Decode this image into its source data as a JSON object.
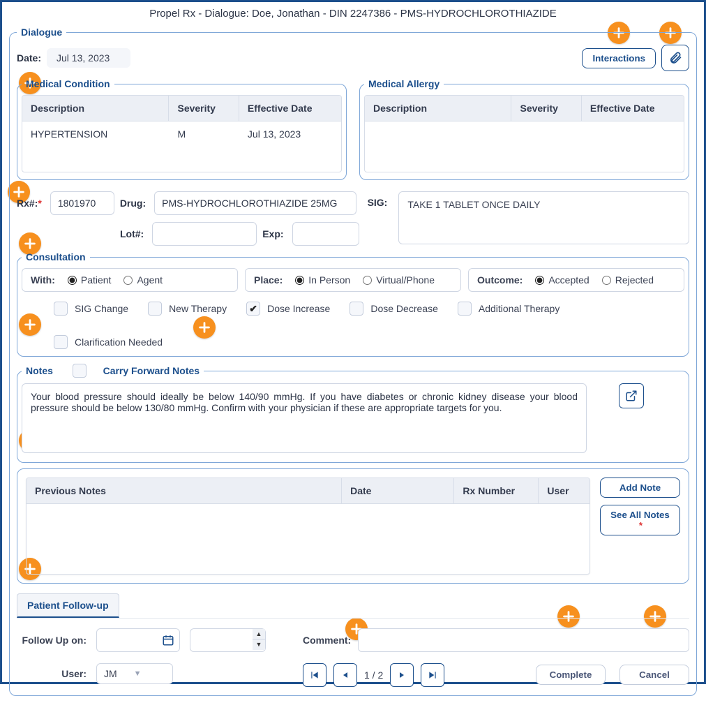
{
  "window_title": "Propel Rx - Dialogue: Doe, Jonathan - DIN 2247386 - PMS-HYDROCHLOROTHIAZIDE",
  "dialogue": {
    "legend": "Dialogue",
    "date_label": "Date:",
    "date_value": "Jul 13, 2023",
    "interactions_button": "Interactions"
  },
  "med_condition": {
    "legend": "Medical Condition",
    "cols": {
      "desc": "Description",
      "sev": "Severity",
      "eff": "Effective Date"
    },
    "rows": [
      {
        "desc": "HYPERTENSION",
        "sev": "M",
        "eff": "Jul 13, 2023"
      }
    ]
  },
  "med_allergy": {
    "legend": "Medical Allergy",
    "cols": {
      "desc": "Description",
      "sev": "Severity",
      "eff": "Effective Date"
    }
  },
  "rx": {
    "rx_label": "Rx#:",
    "rx_value": "1801970",
    "drug_label": "Drug:",
    "drug_value": "PMS-HYDROCHLOROTHIAZIDE 25MG",
    "lot_label": "Lot#:",
    "lot_value": "",
    "exp_label": "Exp:",
    "exp_value": "",
    "sig_label": "SIG:",
    "sig_value": "TAKE 1 TABLET ONCE DAILY"
  },
  "consult": {
    "legend": "Consultation",
    "with_label": "With:",
    "with_options": {
      "patient": "Patient",
      "agent": "Agent"
    },
    "with_selected": "patient",
    "place_label": "Place:",
    "place_options": {
      "inperson": "In Person",
      "virtual": "Virtual/Phone"
    },
    "place_selected": "inperson",
    "outcome_label": "Outcome:",
    "outcome_options": {
      "accepted": "Accepted",
      "rejected": "Rejected"
    },
    "outcome_selected": "accepted",
    "checks": {
      "sig_change": "SIG Change",
      "new_therapy": "New Therapy",
      "dose_increase": "Dose Increase",
      "dose_decrease": "Dose Decrease",
      "add_therapy": "Additional Therapy",
      "clarification": "Clarification Needed"
    },
    "checked": [
      "dose_increase"
    ]
  },
  "notes": {
    "legend": "Notes",
    "carry_forward_label": "Carry Forward Notes",
    "text": "Your blood pressure should ideally be below 140/90 mmHg. If you have diabetes or chronic kidney disease your blood pressure should be below 130/80 mmHg. Confirm with your physician if these are appropriate targets for you."
  },
  "prev_notes": {
    "cols": {
      "prev": "Previous Notes",
      "date": "Date",
      "rx": "Rx Number",
      "user": "User"
    },
    "add_button": "Add Note",
    "see_all_button": "See All Notes"
  },
  "followup": {
    "tab_label": "Patient Follow-up",
    "followup_on_label": "Follow Up on:",
    "user_label": "User:",
    "user_value": "JM",
    "comment_label": "Comment:",
    "comment_value": "",
    "pager_text": "1 / 2",
    "complete_button": "Complete",
    "cancel_button": "Cancel"
  },
  "colors": {
    "accent": "#1c4f8c",
    "hotspot": "#f7901e"
  }
}
